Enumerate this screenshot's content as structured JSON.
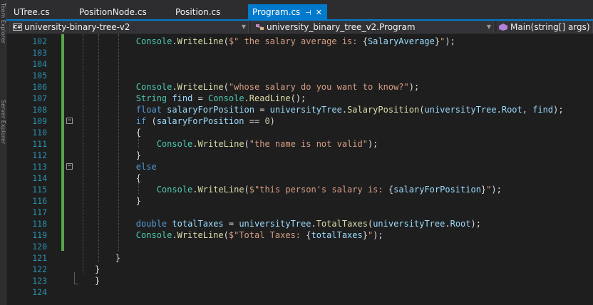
{
  "side_tabs": [
    "Team Explorer",
    "Server Explorer"
  ],
  "tabs": [
    {
      "label": "UTree.cs",
      "active": false
    },
    {
      "label": "PositionNode.cs",
      "active": false
    },
    {
      "label": "Position.cs",
      "active": false
    },
    {
      "label": "Program.cs",
      "active": true,
      "pin_icon": "pin-icon",
      "close_icon": "close-icon"
    }
  ],
  "navbar": {
    "project": "university-binary-tree-v2",
    "class": "university_binary_tree_v2.Program",
    "member": "Main(string[] args)"
  },
  "colors": {
    "accent": "#007acc",
    "change_bar": "#57a64a",
    "line_number": "#2b91af",
    "keyword": "#569cd6",
    "string": "#d69d85",
    "type": "#4ec9b0",
    "method": "#dcdcaa",
    "number": "#b5cea8"
  },
  "lines": [
    {
      "n": "102",
      "tokens": [
        [
          "pl",
          "        "
        ],
        [
          "type",
          "Console"
        ],
        [
          "pl",
          "."
        ],
        [
          "mth",
          "WriteLine"
        ],
        [
          "pl",
          "("
        ],
        [
          "str",
          "$\" the salary average is: "
        ],
        [
          "pl",
          "{"
        ],
        [
          "id",
          "SalaryAverage"
        ],
        [
          "pl",
          "}"
        ],
        [
          "str",
          "\""
        ],
        [
          "pl",
          ");"
        ]
      ]
    },
    {
      "n": "103",
      "tokens": []
    },
    {
      "n": "104",
      "tokens": []
    },
    {
      "n": "105",
      "tokens": []
    },
    {
      "n": "106",
      "tokens": [
        [
          "pl",
          "        "
        ],
        [
          "type",
          "Console"
        ],
        [
          "pl",
          "."
        ],
        [
          "mth",
          "WriteLine"
        ],
        [
          "pl",
          "("
        ],
        [
          "str",
          "\"whose salary do you want to know?\""
        ],
        [
          "pl",
          ");"
        ]
      ]
    },
    {
      "n": "107",
      "tokens": [
        [
          "pl",
          "        "
        ],
        [
          "type",
          "String"
        ],
        [
          "pl",
          " "
        ],
        [
          "id",
          "find"
        ],
        [
          "pl",
          " = "
        ],
        [
          "type",
          "Console"
        ],
        [
          "pl",
          "."
        ],
        [
          "mth",
          "ReadLine"
        ],
        [
          "pl",
          "();"
        ]
      ]
    },
    {
      "n": "108",
      "tokens": [
        [
          "pl",
          "        "
        ],
        [
          "kw",
          "float"
        ],
        [
          "pl",
          " "
        ],
        [
          "id",
          "salaryForPosition"
        ],
        [
          "pl",
          " = "
        ],
        [
          "id",
          "universityTree"
        ],
        [
          "pl",
          "."
        ],
        [
          "mth",
          "SalaryPosition"
        ],
        [
          "pl",
          "("
        ],
        [
          "id",
          "universityTree"
        ],
        [
          "pl",
          "."
        ],
        [
          "id",
          "Root"
        ],
        [
          "pl",
          ", "
        ],
        [
          "id",
          "find"
        ],
        [
          "pl",
          ");"
        ]
      ]
    },
    {
      "n": "109",
      "tokens": [
        [
          "pl",
          "        "
        ],
        [
          "kw",
          "if"
        ],
        [
          "pl",
          " ("
        ],
        [
          "id",
          "salaryForPosition"
        ],
        [
          "pl",
          " == "
        ],
        [
          "num",
          "0"
        ],
        [
          "pl",
          ")"
        ]
      ]
    },
    {
      "n": "110",
      "tokens": [
        [
          "pl",
          "        {"
        ]
      ]
    },
    {
      "n": "111",
      "tokens": [
        [
          "pl",
          "            "
        ],
        [
          "type",
          "Console"
        ],
        [
          "pl",
          "."
        ],
        [
          "mth",
          "WriteLine"
        ],
        [
          "pl",
          "("
        ],
        [
          "str",
          "\"the name is not valid\""
        ],
        [
          "pl",
          ");"
        ]
      ]
    },
    {
      "n": "112",
      "tokens": [
        [
          "pl",
          "        }"
        ]
      ]
    },
    {
      "n": "113",
      "tokens": [
        [
          "pl",
          "        "
        ],
        [
          "kw",
          "else"
        ]
      ]
    },
    {
      "n": "114",
      "tokens": [
        [
          "pl",
          "        {"
        ]
      ]
    },
    {
      "n": "115",
      "tokens": [
        [
          "pl",
          "            "
        ],
        [
          "type",
          "Console"
        ],
        [
          "pl",
          "."
        ],
        [
          "mth",
          "WriteLine"
        ],
        [
          "pl",
          "("
        ],
        [
          "str",
          "$\"this person's salary is: "
        ],
        [
          "pl",
          "{"
        ],
        [
          "id",
          "salaryForPosition"
        ],
        [
          "pl",
          "}"
        ],
        [
          "str",
          "\""
        ],
        [
          "pl",
          ");"
        ]
      ]
    },
    {
      "n": "116",
      "tokens": [
        [
          "pl",
          "        }"
        ]
      ]
    },
    {
      "n": "117",
      "tokens": []
    },
    {
      "n": "118",
      "tokens": [
        [
          "pl",
          "        "
        ],
        [
          "kw",
          "double"
        ],
        [
          "pl",
          " "
        ],
        [
          "id",
          "totalTaxes"
        ],
        [
          "pl",
          " = "
        ],
        [
          "id",
          "universityTree"
        ],
        [
          "pl",
          "."
        ],
        [
          "mth",
          "TotalTaxes"
        ],
        [
          "pl",
          "("
        ],
        [
          "id",
          "universityTree"
        ],
        [
          "pl",
          "."
        ],
        [
          "id",
          "Root"
        ],
        [
          "pl",
          ");"
        ]
      ]
    },
    {
      "n": "119",
      "tokens": [
        [
          "pl",
          "        "
        ],
        [
          "type",
          "Console"
        ],
        [
          "pl",
          "."
        ],
        [
          "mth",
          "WriteLine"
        ],
        [
          "pl",
          "("
        ],
        [
          "str",
          "$\"Total Taxes: "
        ],
        [
          "pl",
          "{"
        ],
        [
          "id",
          "totalTaxes"
        ],
        [
          "pl",
          "}"
        ],
        [
          "str",
          "\""
        ],
        [
          "pl",
          ");"
        ]
      ]
    },
    {
      "n": "120",
      "tokens": []
    },
    {
      "n": "121",
      "tokens": [
        [
          "pl",
          "    }"
        ]
      ]
    },
    {
      "n": "122",
      "tokens": [
        [
          "pl",
          "}"
        ]
      ]
    },
    {
      "n": "123",
      "tokens": [
        [
          "pl",
          "}"
        ]
      ]
    },
    {
      "n": "124",
      "tokens": []
    }
  ]
}
